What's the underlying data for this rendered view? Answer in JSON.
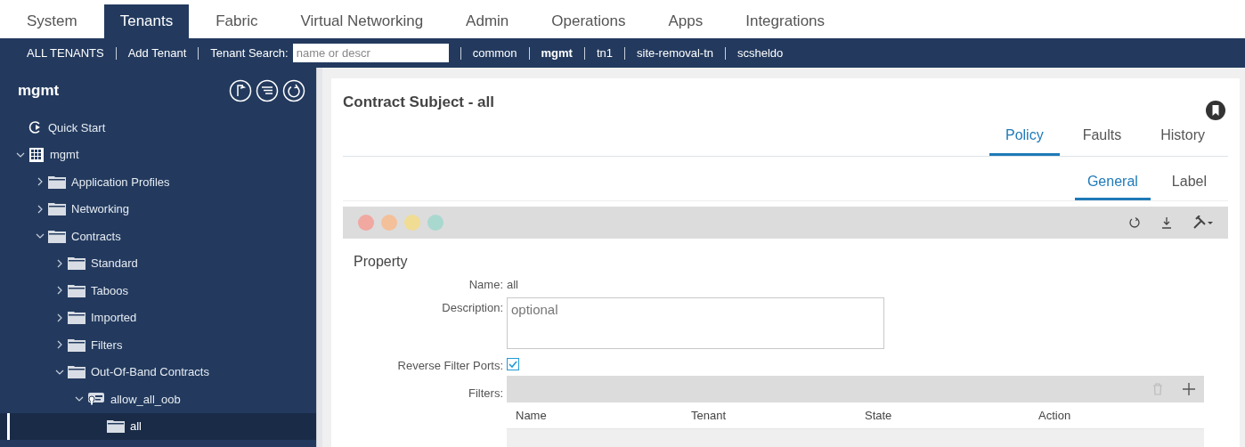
{
  "nav": {
    "tabs": [
      {
        "label": "System",
        "selected": false
      },
      {
        "label": "Tenants",
        "selected": true
      },
      {
        "label": "Fabric",
        "selected": false
      },
      {
        "label": "Virtual Networking",
        "selected": false
      },
      {
        "label": "Admin",
        "selected": false
      },
      {
        "label": "Operations",
        "selected": false
      },
      {
        "label": "Apps",
        "selected": false
      },
      {
        "label": "Integrations",
        "selected": false
      }
    ]
  },
  "subnav": {
    "items": [
      {
        "kind": "link",
        "label": "ALL TENANTS",
        "selected": false
      },
      {
        "kind": "link",
        "label": "Add Tenant",
        "selected": false
      },
      {
        "kind": "search",
        "label": "Tenant Search:",
        "placeholder": "name or descr"
      },
      {
        "kind": "link",
        "label": "common",
        "selected": false
      },
      {
        "kind": "link",
        "label": "mgmt",
        "selected": true
      },
      {
        "kind": "link",
        "label": "tn1",
        "selected": false
      },
      {
        "kind": "link",
        "label": "site-removal-tn",
        "selected": false
      },
      {
        "kind": "link",
        "label": "scsheldo",
        "selected": false
      }
    ]
  },
  "sidebar": {
    "title": "mgmt",
    "tree": [
      {
        "label": "Quick Start",
        "kind": "quickstart",
        "selected": false
      },
      {
        "label": "mgmt",
        "kind": "tenant",
        "expanded": true,
        "selected": false,
        "children": [
          {
            "label": "Application Profiles",
            "kind": "folder",
            "expanded": false,
            "selected": false
          },
          {
            "label": "Networking",
            "kind": "folder",
            "expanded": false,
            "selected": false
          },
          {
            "label": "Contracts",
            "kind": "folder",
            "expanded": true,
            "selected": false,
            "children": [
              {
                "label": "Standard",
                "kind": "folder",
                "expanded": false,
                "selected": false
              },
              {
                "label": "Taboos",
                "kind": "folder",
                "expanded": false,
                "selected": false
              },
              {
                "label": "Imported",
                "kind": "folder",
                "expanded": false,
                "selected": false
              },
              {
                "label": "Filters",
                "kind": "folder",
                "expanded": false,
                "selected": false
              },
              {
                "label": "Out-Of-Band Contracts",
                "kind": "folder",
                "expanded": true,
                "selected": false,
                "children": [
                  {
                    "label": "allow_all_oob",
                    "kind": "contract",
                    "expanded": true,
                    "selected": false,
                    "children": [
                      {
                        "label": "all",
                        "kind": "folder",
                        "selected": true
                      }
                    ]
                  }
                ]
              }
            ]
          }
        ]
      }
    ]
  },
  "content": {
    "title": "Contract Subject - all",
    "tabs": [
      {
        "label": "Policy",
        "selected": true
      },
      {
        "label": "Faults",
        "selected": false
      },
      {
        "label": "History",
        "selected": false
      }
    ],
    "subtabs": [
      {
        "label": "General",
        "selected": true
      },
      {
        "label": "Label",
        "selected": false
      }
    ],
    "property": {
      "heading": "Property",
      "name_label": "Name:",
      "name_value": "all",
      "description_label": "Description:",
      "description_placeholder": "optional",
      "reverse_label": "Reverse Filter Ports:",
      "reverse_checked": true,
      "filters_label": "Filters:",
      "columns": [
        "Name",
        "Tenant",
        "State",
        "Action"
      ]
    }
  }
}
